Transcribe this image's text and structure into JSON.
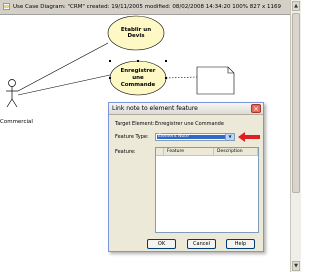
{
  "window": {
    "title": "Use Case Diagram: \"CRM\"  created: 19/11/2005  modified: 08/02/2008 14:34:20  100%  827 x 1169"
  },
  "diagram": {
    "usecases": [
      {
        "label": "Etablir un Devis"
      },
      {
        "label": "Enregistrer une Commande"
      }
    ],
    "actor": {
      "label": "Commercial"
    }
  },
  "dialog": {
    "title": "Link note to element feature",
    "target_label": "Target Element:",
    "target_value": "Enregistrer une Commande",
    "feature_type_label": "Feature Type:",
    "feature_type_value": "Element Note",
    "feature_label": "Feature:",
    "columns": [
      "Feature",
      "Description"
    ],
    "buttons": {
      "ok": "OK",
      "cancel": "Cancel",
      "help": "Help"
    }
  },
  "colors": {
    "usecase_fill": "#fdf8c4",
    "dialog_bg": "#ece9d8",
    "selection": "#316ac5",
    "pointer_arrow": "#e02020"
  }
}
